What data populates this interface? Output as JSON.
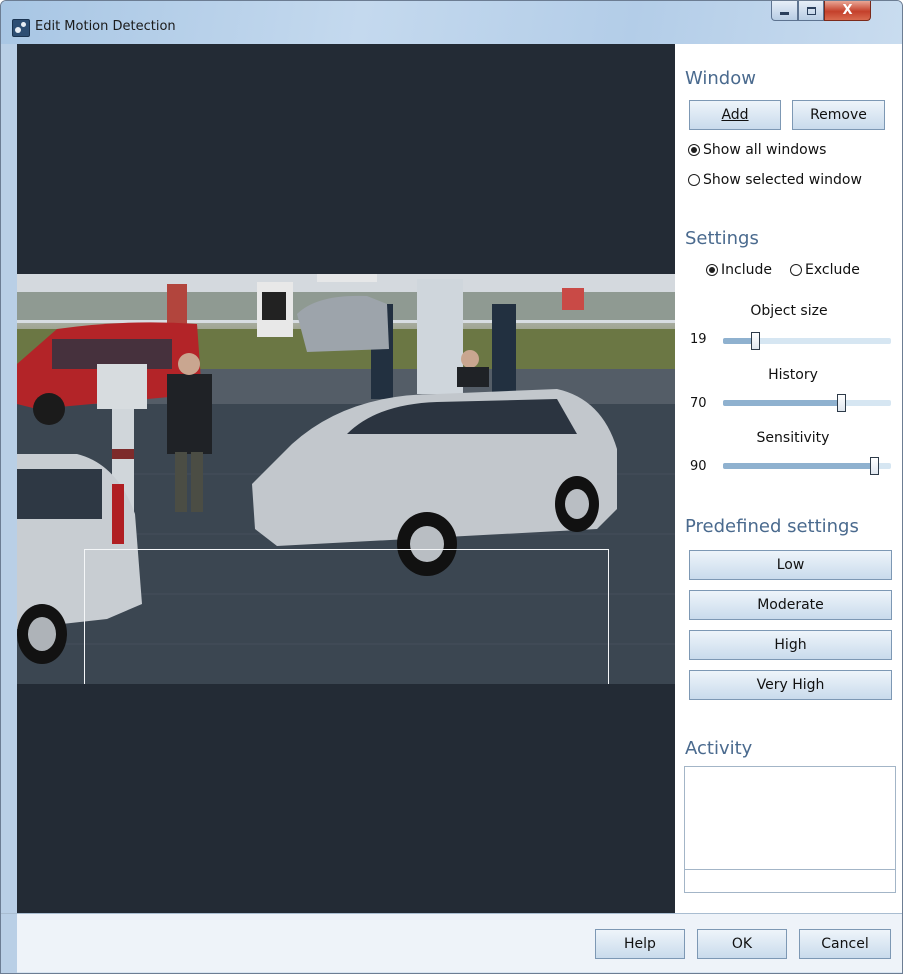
{
  "window": {
    "title": "Edit Motion Detection",
    "controls": {
      "minimize_icon": "minimize-icon",
      "maximize_icon": "maximize-icon",
      "close_icon": "close-icon",
      "close_glyph": "X"
    }
  },
  "panel": {
    "window_section": {
      "title": "Window",
      "add_label": "Add",
      "remove_label": "Remove",
      "view_options": [
        {
          "label": "Show all windows",
          "selected": true
        },
        {
          "label": "Show selected window",
          "selected": false
        }
      ]
    },
    "settings_section": {
      "title": "Settings",
      "mode_options": [
        {
          "label": "Include",
          "selected": true
        },
        {
          "label": "Exclude",
          "selected": false
        }
      ],
      "sliders": [
        {
          "label": "Object size",
          "value": "19",
          "level": 0.19
        },
        {
          "label": "History",
          "value": "70",
          "level": 0.7
        },
        {
          "label": "Sensitivity",
          "value": "90",
          "level": 0.9
        }
      ]
    },
    "predefined_section": {
      "title": "Predefined settings",
      "buttons": [
        "Low",
        "Moderate",
        "High",
        "Very High"
      ]
    },
    "activity_section": {
      "title": "Activity"
    }
  },
  "footer": {
    "help_label": "Help",
    "ok_label": "OK",
    "cancel_label": "Cancel"
  }
}
